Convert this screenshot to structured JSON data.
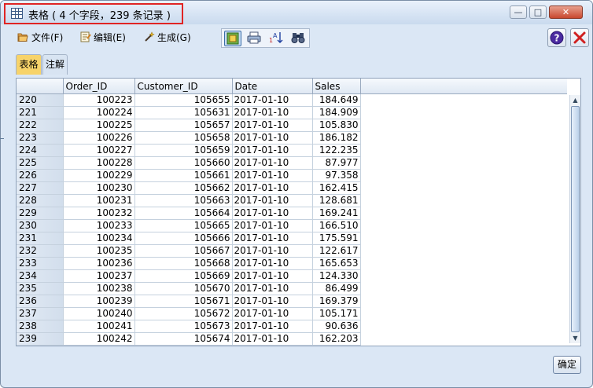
{
  "window": {
    "title": "表格 ( 4 个字段，239 条记录 )",
    "controls": {
      "minimize": "—",
      "maximize": "□",
      "close": "✕"
    }
  },
  "menu": {
    "file": "文件(F)",
    "edit": "编辑(E)",
    "generate": "生成(G)"
  },
  "tabs": [
    {
      "label": "表格",
      "active": true
    },
    {
      "label": "注解",
      "active": false
    }
  ],
  "table": {
    "columns": [
      "Order_ID",
      "Customer_ID",
      "Date",
      "Sales"
    ],
    "rows": [
      {
        "n": "220",
        "order_id": "100223",
        "customer_id": "105655",
        "date": "2017-01-10",
        "sales": "184.649"
      },
      {
        "n": "221",
        "order_id": "100224",
        "customer_id": "105631",
        "date": "2017-01-10",
        "sales": "184.909"
      },
      {
        "n": "222",
        "order_id": "100225",
        "customer_id": "105657",
        "date": "2017-01-10",
        "sales": "105.830"
      },
      {
        "n": "223",
        "order_id": "100226",
        "customer_id": "105658",
        "date": "2017-01-10",
        "sales": "186.182"
      },
      {
        "n": "224",
        "order_id": "100227",
        "customer_id": "105659",
        "date": "2017-01-10",
        "sales": "122.235"
      },
      {
        "n": "225",
        "order_id": "100228",
        "customer_id": "105660",
        "date": "2017-01-10",
        "sales": "87.977"
      },
      {
        "n": "226",
        "order_id": "100229",
        "customer_id": "105661",
        "date": "2017-01-10",
        "sales": "97.358"
      },
      {
        "n": "227",
        "order_id": "100230",
        "customer_id": "105662",
        "date": "2017-01-10",
        "sales": "162.415"
      },
      {
        "n": "228",
        "order_id": "100231",
        "customer_id": "105663",
        "date": "2017-01-10",
        "sales": "128.681"
      },
      {
        "n": "229",
        "order_id": "100232",
        "customer_id": "105664",
        "date": "2017-01-10",
        "sales": "169.241"
      },
      {
        "n": "230",
        "order_id": "100233",
        "customer_id": "105665",
        "date": "2017-01-10",
        "sales": "166.510"
      },
      {
        "n": "231",
        "order_id": "100234",
        "customer_id": "105666",
        "date": "2017-01-10",
        "sales": "175.591"
      },
      {
        "n": "232",
        "order_id": "100235",
        "customer_id": "105667",
        "date": "2017-01-10",
        "sales": "122.617"
      },
      {
        "n": "233",
        "order_id": "100236",
        "customer_id": "105668",
        "date": "2017-01-10",
        "sales": "165.653"
      },
      {
        "n": "234",
        "order_id": "100237",
        "customer_id": "105669",
        "date": "2017-01-10",
        "sales": "124.330"
      },
      {
        "n": "235",
        "order_id": "100238",
        "customer_id": "105670",
        "date": "2017-01-10",
        "sales": "86.499"
      },
      {
        "n": "236",
        "order_id": "100239",
        "customer_id": "105671",
        "date": "2017-01-10",
        "sales": "169.379"
      },
      {
        "n": "237",
        "order_id": "100240",
        "customer_id": "105672",
        "date": "2017-01-10",
        "sales": "105.171"
      },
      {
        "n": "238",
        "order_id": "100241",
        "customer_id": "105673",
        "date": "2017-01-10",
        "sales": "90.636"
      },
      {
        "n": "239",
        "order_id": "100242",
        "customer_id": "105674",
        "date": "2017-01-10",
        "sales": "162.203"
      }
    ]
  },
  "footer": {
    "ok_label": "确定"
  },
  "colors": {
    "highlight_box": "#e02424",
    "active_tab": "#f7d36a",
    "window_bg": "#dbe7f5"
  },
  "icons": {
    "title": "table-icon",
    "file": "folder-icon",
    "edit": "notepad-icon",
    "generate": "wand-icon",
    "tools": [
      "insert-node-icon",
      "print-icon",
      "sort-icon",
      "binoculars-icon"
    ],
    "help": "help-icon",
    "exit": "close-icon",
    "scroll_up": "arrow-up-icon",
    "scroll_down": "arrow-down-icon"
  }
}
